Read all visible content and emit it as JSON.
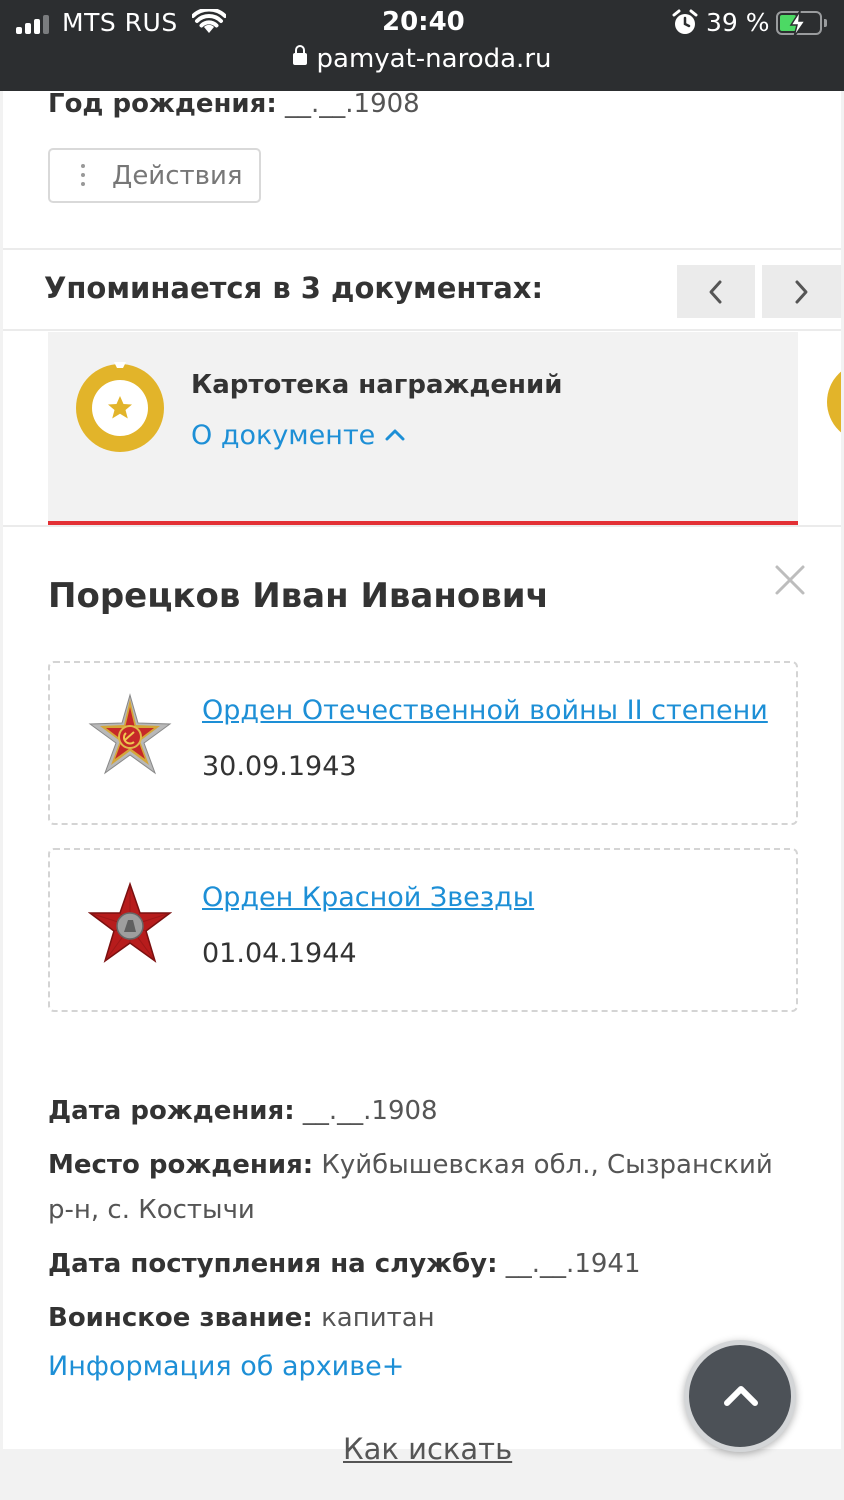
{
  "status_bar": {
    "carrier": "MTS RUS",
    "time": "20:40",
    "battery": "39 %",
    "url": "pamyat-naroda.ru"
  },
  "top": {
    "birth_year_label": "Год рождения:",
    "birth_year_value": "__.__.1908",
    "actions_label": "Действия"
  },
  "mentions": {
    "title": "Упоминается в 3 документах:"
  },
  "document": {
    "name": "Картотека награждений",
    "about_link": "О документе"
  },
  "person": {
    "name": "Порецков Иван Иванович"
  },
  "awards": [
    {
      "title": "Орден Отечественной войны II степени",
      "date": "30.09.1943"
    },
    {
      "title": "Орден Красной Звезды",
      "date": "01.04.1944"
    }
  ],
  "info": {
    "birth_date_label": "Дата рождения:",
    "birth_date_value": "__.__.1908",
    "birth_place_label": "Место рождения:",
    "birth_place_value": "Куйбышевская обл., Сызранский р-н, с. Костычи",
    "service_date_label": "Дата поступления на службу:",
    "service_date_value": "__.__.1941",
    "rank_label": "Воинское звание:",
    "rank_value": "капитан",
    "archive_link": "Информация об архиве+"
  },
  "footer": {
    "how_to_search": "Как искать"
  },
  "colors": {
    "link": "#1d8fd6",
    "accent_red": "#e33035",
    "medal_gold": "#e2b42a",
    "topbar": "#2c2e30"
  }
}
